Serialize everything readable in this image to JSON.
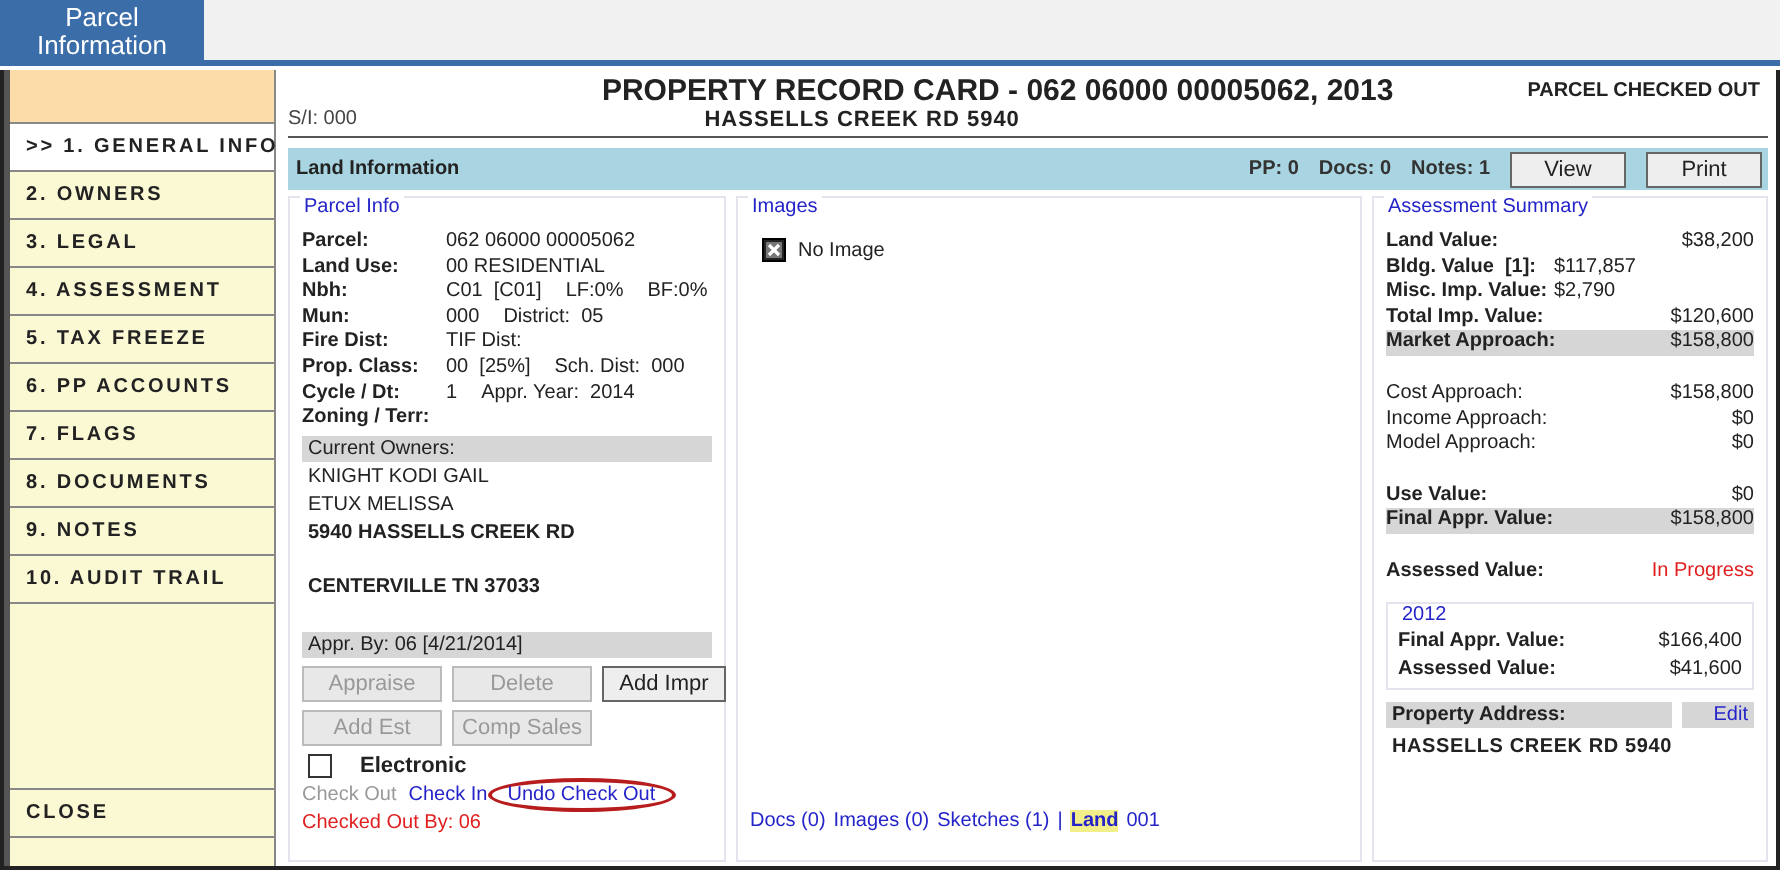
{
  "tabs": [
    {
      "label": "Parcel Information",
      "selected": true
    }
  ],
  "sidebar": {
    "items": [
      {
        "label": ">> 1. GENERAL INFO",
        "selected": true
      },
      {
        "label": "2. OWNERS",
        "selected": false
      },
      {
        "label": "3. LEGAL",
        "selected": false
      },
      {
        "label": "4. ASSESSMENT",
        "selected": false
      },
      {
        "label": "5. TAX FREEZE",
        "selected": false
      },
      {
        "label": "6. PP ACCOUNTS",
        "selected": false
      },
      {
        "label": "7. FLAGS",
        "selected": false
      },
      {
        "label": "8. DOCUMENTS",
        "selected": false
      },
      {
        "label": "9. NOTES",
        "selected": false
      },
      {
        "label": "10. AUDIT TRAIL",
        "selected": false
      }
    ],
    "close": "CLOSE"
  },
  "header": {
    "title": "PROPERTY RECORD CARD - 062 06000 00005062, 2013",
    "status": "PARCEL CHECKED OUT",
    "si": "S/I: 000",
    "address": "HASSELLS CREEK RD 5940"
  },
  "land_bar": {
    "title": "Land Information",
    "pp": "PP: 0",
    "docs": "Docs: 0",
    "notes": "Notes: 1",
    "buttons": [
      "View",
      "Print"
    ]
  },
  "parcel_info": {
    "legend": "Parcel Info",
    "rows": [
      {
        "label": "Parcel:",
        "values": [
          "062 06000 00005062"
        ]
      },
      {
        "label": "Land Use:",
        "values": [
          "00 RESIDENTIAL"
        ]
      },
      {
        "label": "Nbh:",
        "values": [
          "C01  [C01]",
          "LF:0%",
          "BF:0%"
        ]
      },
      {
        "label": "Mun:",
        "values": [
          "000",
          "District:  05"
        ]
      },
      {
        "label": "Fire Dist:",
        "values": [
          "TIF Dist:"
        ]
      },
      {
        "label": "Prop. Class:",
        "values": [
          "00  [25%]",
          "Sch. Dist:  000"
        ]
      },
      {
        "label": "Cycle / Dt:",
        "values": [
          "1",
          "Appr. Year:  2014"
        ]
      },
      {
        "label": "Zoning / Terr:",
        "values": []
      }
    ],
    "owners_header": "Current Owners:",
    "owners": [
      {
        "text": "KNIGHT KODI GAIL",
        "bold": false
      },
      {
        "text": "ETUX MELISSA",
        "bold": false
      },
      {
        "text": "5940 HASSELLS CREEK RD",
        "bold": true
      },
      {
        "text": "CENTERVILLE TN 37033",
        "bold": true,
        "gap_before": true
      }
    ],
    "appr_by": "Appr. By: 06 [4/21/2014]",
    "buttons": [
      {
        "label": "Appraise",
        "disabled": true
      },
      {
        "label": "Delete",
        "disabled": true
      },
      {
        "label": "Add Impr",
        "disabled": false
      },
      {
        "label": "Add Est",
        "disabled": true
      },
      {
        "label": "Comp Sales",
        "disabled": true
      }
    ],
    "electronic": {
      "label": "Electronic",
      "checked": false
    },
    "links": [
      {
        "label": "Check Out",
        "disabled": true,
        "circled": false
      },
      {
        "label": "Check In",
        "disabled": false,
        "circled": false
      },
      {
        "label": "Undo Check Out",
        "disabled": false,
        "circled": true
      }
    ],
    "checked_out_by": "Checked Out By: 06"
  },
  "images": {
    "legend": "Images",
    "empty": "No Image",
    "links": [
      {
        "label": "Docs (0)",
        "highlighted": false
      },
      {
        "label": "Images (0)",
        "highlighted": false
      },
      {
        "label": "Sketches (1)",
        "highlighted": false
      },
      {
        "label": "|",
        "highlighted": false
      },
      {
        "label": "Land",
        "highlighted": true
      },
      {
        "label": "001",
        "highlighted": false
      }
    ]
  },
  "assessment": {
    "legend": "Assessment Summary",
    "rows": [
      {
        "kind": "right",
        "label": "Land Value:",
        "value": "$38,200",
        "bold": true,
        "shaded": false
      },
      {
        "kind": "middle",
        "label": "Bldg. Value  [1]:",
        "value": "$117,857",
        "bold": true,
        "shaded": false
      },
      {
        "kind": "middle",
        "label": "Misc. Imp. Value:",
        "value": "$2,790",
        "bold": true,
        "shaded": false
      },
      {
        "kind": "right",
        "label": "Total Imp. Value:",
        "value": "$120,600",
        "bold": true,
        "shaded": false
      },
      {
        "kind": "right",
        "label": "Market Approach:",
        "value": "$158,800",
        "bold": true,
        "shaded": true
      },
      {
        "kind": "right",
        "label": "Cost Approach:",
        "value": "$158,800",
        "bold": false,
        "shaded": false,
        "gap_before": true
      },
      {
        "kind": "right",
        "label": "Income Approach:",
        "value": "$0",
        "bold": false,
        "shaded": false
      },
      {
        "kind": "right",
        "label": "Model Approach:",
        "value": "$0",
        "bold": false,
        "shaded": false
      },
      {
        "kind": "right",
        "label": "Use Value:",
        "value": "$0",
        "bold": true,
        "shaded": false,
        "gap_before": true
      },
      {
        "kind": "right",
        "label": "Final Appr. Value:",
        "value": "$158,800",
        "bold": true,
        "shaded": true
      },
      {
        "kind": "status",
        "label": "Assessed Value:",
        "value": "In Progress",
        "bold": true,
        "shaded": false,
        "gap_before": true
      }
    ],
    "prior": {
      "legend": "2012",
      "rows": [
        {
          "label": "Final Appr. Value:",
          "value": "$166,400"
        },
        {
          "label": "Assessed Value:",
          "value": "$41,600"
        }
      ]
    },
    "address_header": "Property Address:",
    "edit": "Edit",
    "address": "HASSELLS CREEK RD 5940"
  }
}
